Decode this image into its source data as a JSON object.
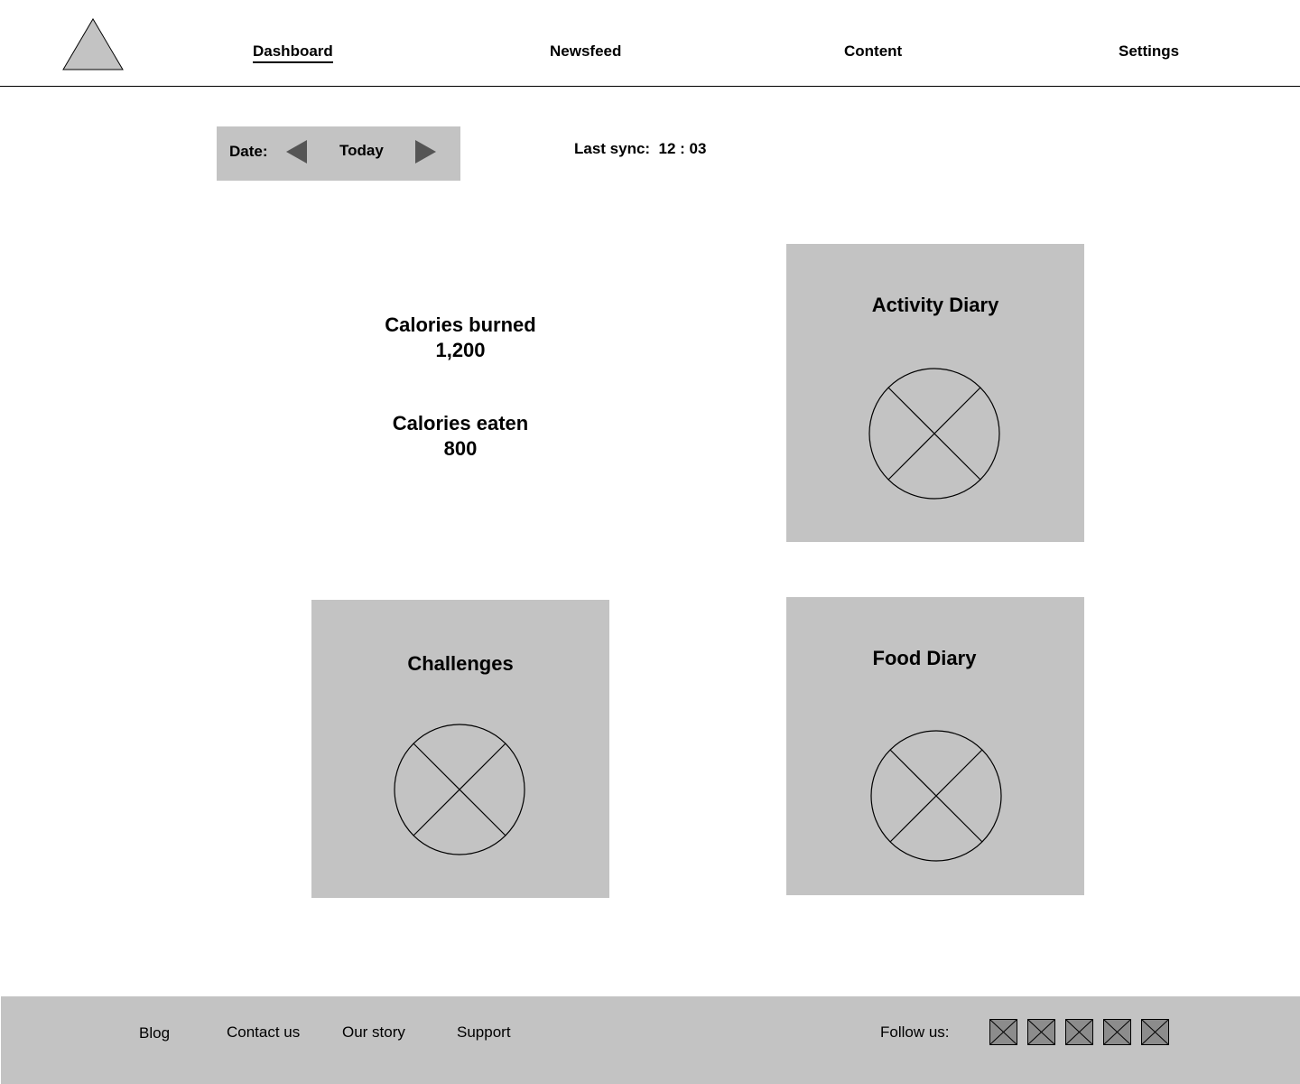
{
  "header": {
    "logo_icon": "triangle-logo-icon",
    "nav": [
      {
        "label": "Dashboard",
        "active": true
      },
      {
        "label": "Newsfeed",
        "active": false
      },
      {
        "label": "Content",
        "active": false
      },
      {
        "label": "Settings",
        "active": false
      }
    ]
  },
  "date_selector": {
    "label": "Date:",
    "value": "Today",
    "prev_icon": "triangle-left-icon",
    "next_icon": "triangle-right-icon"
  },
  "sync": {
    "text": "Last sync:  12 : 03"
  },
  "stats": {
    "burned_label": "Calories burned",
    "burned_value": "1,200",
    "eaten_label": "Calories eaten",
    "eaten_value": "800"
  },
  "cards": [
    {
      "title": "Activity Diary",
      "image_icon": "image-placeholder-icon"
    },
    {
      "title": "Challenges",
      "image_icon": "image-placeholder-icon"
    },
    {
      "title": "Food Diary",
      "image_icon": "image-placeholder-icon"
    }
  ],
  "footer": {
    "links": [
      "Blog",
      "Contact us",
      "Our story",
      "Support"
    ],
    "follow_label": "Follow us:",
    "social_icons": [
      "social-icon",
      "social-icon",
      "social-icon",
      "social-icon",
      "social-icon"
    ]
  },
  "colors": {
    "panel_gray": "#c3c3c3",
    "arrow_gray": "#555555",
    "social_icon_gray": "#8c8c8c"
  }
}
